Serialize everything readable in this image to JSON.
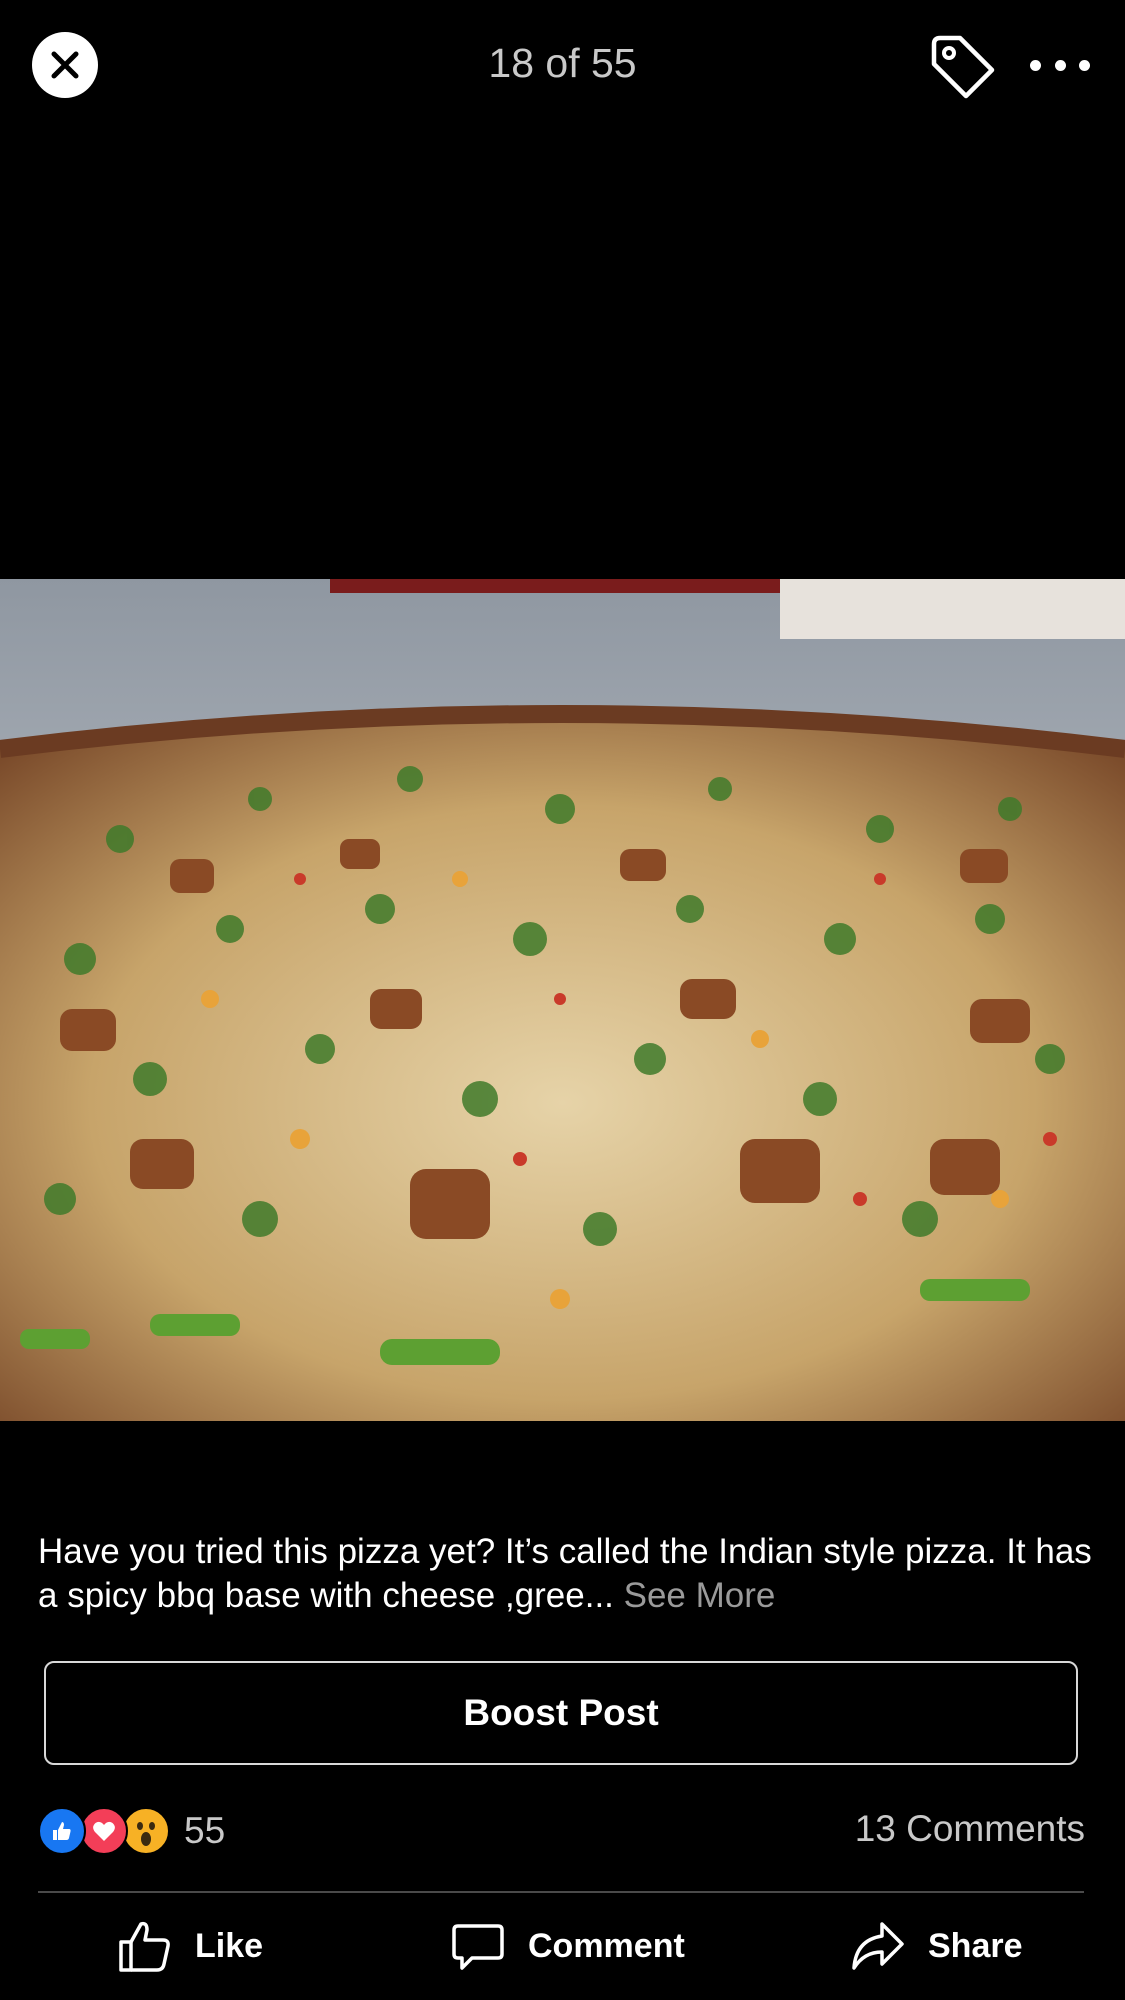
{
  "header": {
    "counter_text": "18 of 55",
    "close_icon": "close-icon",
    "tag_icon": "tag-icon",
    "more_icon": "more-dots-icon"
  },
  "photo": {
    "subject": "pizza"
  },
  "caption": {
    "text": "Have you tried this pizza yet? It’s called the Indian style pizza. It has a spicy bbq base with cheese ,gree... ",
    "see_more": "See More"
  },
  "boost_button": {
    "label": "Boost Post"
  },
  "engagement": {
    "reaction_count": "55",
    "comments_text": "13 Comments",
    "reactions": [
      "like-reaction-icon",
      "love-reaction-icon",
      "wow-reaction-icon"
    ]
  },
  "actions": {
    "like": "Like",
    "comment": "Comment",
    "share": "Share"
  },
  "colors": {
    "background": "#000000",
    "like_blue": "#1877f2",
    "love_red": "#f33e58",
    "wow_yellow": "#f7b125",
    "muted_text": "#c9c9c9"
  }
}
